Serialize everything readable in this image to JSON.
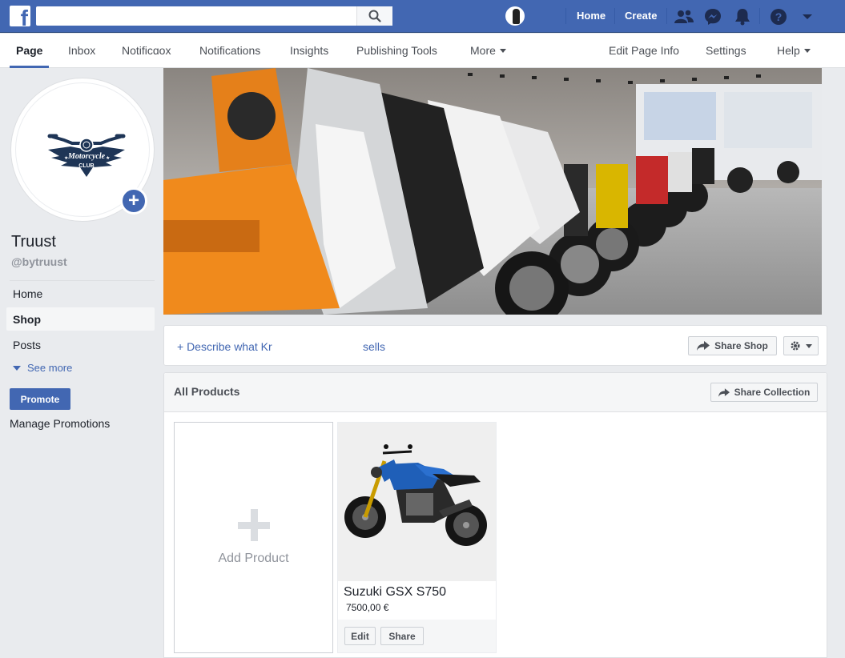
{
  "topbar": {
    "search_placeholder": "",
    "home_label": "Home",
    "create_label": "Create",
    "brand_color": "#4267b2"
  },
  "pagenav": {
    "left_items": [
      "Page",
      "Inbox",
      "Notificɑox",
      "Notifications",
      "Insights",
      "Publishing Tools",
      "More"
    ],
    "right_items": [
      "Edit Page Info",
      "Settings",
      "Help"
    ]
  },
  "profile": {
    "name": "Truust",
    "handle": "@bytruust",
    "logo_text_1": "Motorcycle",
    "logo_text_2": "CLUB"
  },
  "sidebar": {
    "items": [
      {
        "label": "Home"
      },
      {
        "label": "Shop"
      },
      {
        "label": "Posts"
      }
    ],
    "see_more": "See more",
    "promote": "Promote",
    "manage_promotions": "Manage Promotions"
  },
  "shop_bar": {
    "describe_link": "+ Describe what Kr",
    "sells_link": "sells",
    "share_shop": "Share Shop"
  },
  "products": {
    "title": "All Products",
    "share_collection": "Share Collection",
    "add_product": "Add Product",
    "items": [
      {
        "name": "Suzuki GSX S750",
        "price": "7500,00 €",
        "edit": "Edit",
        "share": "Share"
      }
    ]
  }
}
